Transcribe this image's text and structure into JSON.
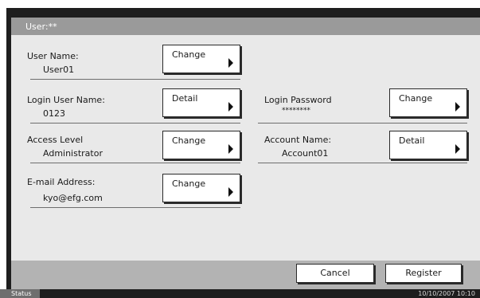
{
  "title": "User:**",
  "fields": [
    {
      "label": "User Name:",
      "value": "User01",
      "button": "Change"
    },
    {
      "label": "Login User Name:",
      "value": "0123",
      "button": "Detail"
    },
    {
      "label": "Login Password",
      "value": "********",
      "button": "Change"
    },
    {
      "label": "Access Level",
      "value": "Administrator",
      "button": "Change"
    },
    {
      "label": "Account Name:",
      "value": "Account01",
      "button": "Detail"
    },
    {
      "label": "E-mail Address:",
      "value": "kyo@efg.com",
      "button": "Change"
    }
  ],
  "footer": {
    "cancel_label": "Cancel",
    "register_label": "Register"
  },
  "status": {
    "status_label": "Status",
    "datetime": "10/10/2007  10:10"
  }
}
